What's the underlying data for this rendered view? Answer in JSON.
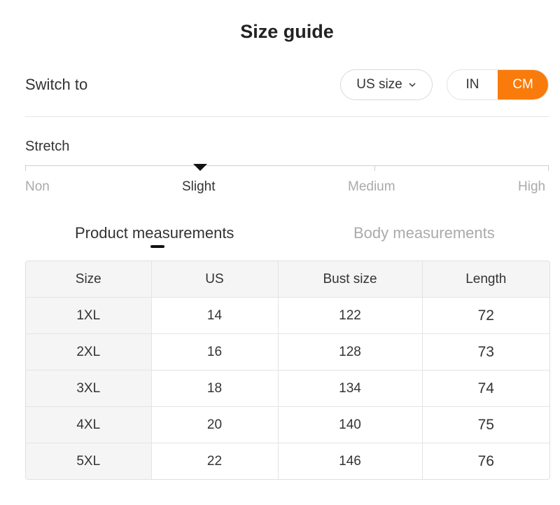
{
  "header": {
    "title": "Size guide"
  },
  "switch": {
    "label": "Switch to",
    "size_select": "US size",
    "units": [
      "IN",
      "CM"
    ],
    "active_unit": "CM",
    "accent_color": "#f97b0b"
  },
  "stretch": {
    "label": "Stretch",
    "levels": [
      "Non",
      "Slight",
      "Medium",
      "High"
    ],
    "selected": "Slight"
  },
  "tabs": [
    {
      "label": "Product measurements",
      "active": true
    },
    {
      "label": "Body measurements",
      "active": false
    }
  ],
  "table": {
    "headers": [
      "Size",
      "US",
      "Bust size",
      "Length"
    ],
    "rows": [
      [
        "1XL",
        "14",
        "122",
        "72"
      ],
      [
        "2XL",
        "16",
        "128",
        "73"
      ],
      [
        "3XL",
        "18",
        "134",
        "74"
      ],
      [
        "4XL",
        "20",
        "140",
        "75"
      ],
      [
        "5XL",
        "22",
        "146",
        "76"
      ]
    ]
  }
}
